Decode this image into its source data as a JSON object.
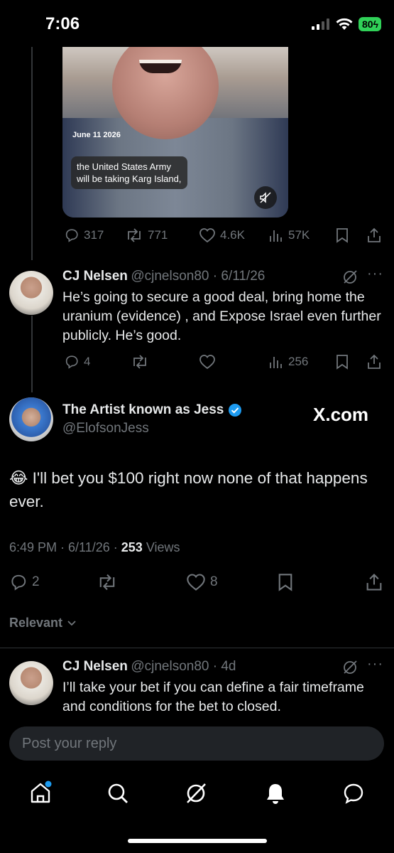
{
  "status_bar": {
    "time": "7:06",
    "battery": "80"
  },
  "parent_tweet": {
    "video": {
      "date_stamp": "June 11 2026",
      "caption": "the United States Army will be taking Karg Island,"
    },
    "stats": {
      "replies": "317",
      "reposts": "771",
      "likes": "4.6K",
      "views": "57K"
    }
  },
  "reply1": {
    "name": "CJ Nelsen",
    "handle": "@cjnelson80",
    "date": "6/11/26",
    "text": "He’s going to secure a good deal, bring home the uranium (evidence) , and Expose Israel even further publicly. He’s good.",
    "stats": {
      "replies": "4",
      "views": "256"
    }
  },
  "main_tweet": {
    "name": "The Artist known as Jess",
    "handle": "@ElofsonJess",
    "watermark": "X.com",
    "emoji": "😂",
    "text": "I'll bet you $100 right now none of that happens ever.",
    "time": "6:49 PM",
    "date": "6/11/26",
    "views_count": "253",
    "views_label": "Views",
    "stats": {
      "replies": "2",
      "likes": "8"
    }
  },
  "sort": {
    "label": "Relevant"
  },
  "reply2": {
    "name": "CJ Nelsen",
    "handle": "@cjnelson80",
    "date": "4d",
    "text": "I’ll take your bet if you can define a fair timeframe and conditions for the bet to closed."
  },
  "reply_input": {
    "placeholder": "Post your reply"
  },
  "colors": {
    "accent": "#1d9bf0",
    "background": "#000000",
    "muted": "#71767b",
    "text": "#e7e9ea",
    "battery": "#30d158"
  },
  "icons": [
    "reply-icon",
    "repost-icon",
    "like-icon",
    "views-icon",
    "bookmark-icon",
    "share-icon",
    "grok-icon",
    "more-icon",
    "verified-icon",
    "home-icon",
    "search-icon",
    "grok-nav-icon",
    "notifications-icon",
    "messages-icon"
  ]
}
